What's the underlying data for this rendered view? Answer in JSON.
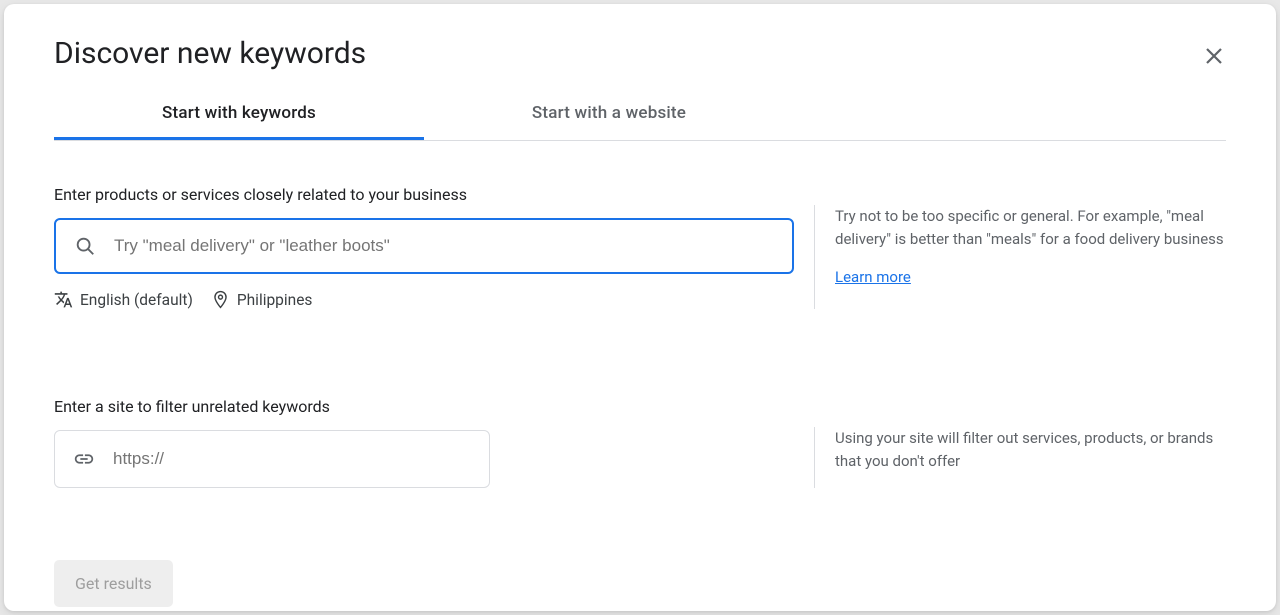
{
  "title": "Discover new keywords",
  "tabs": [
    {
      "label": "Start with keywords",
      "active": true
    },
    {
      "label": "Start with a website",
      "active": false
    }
  ],
  "keywords_section": {
    "label": "Enter products or services closely related to your business",
    "placeholder": "Try \"meal delivery\" or \"leather boots\"",
    "language": "English (default)",
    "location": "Philippines",
    "help_text": "Try not to be too specific or general. For example, \"meal delivery\" is better than \"meals\" for a food delivery business",
    "learn_more": "Learn more"
  },
  "site_section": {
    "label": "Enter a site to filter unrelated keywords",
    "placeholder": "https://",
    "help_text": "Using your site will filter out services, products, or brands that you don't offer"
  },
  "get_results_label": "Get results"
}
